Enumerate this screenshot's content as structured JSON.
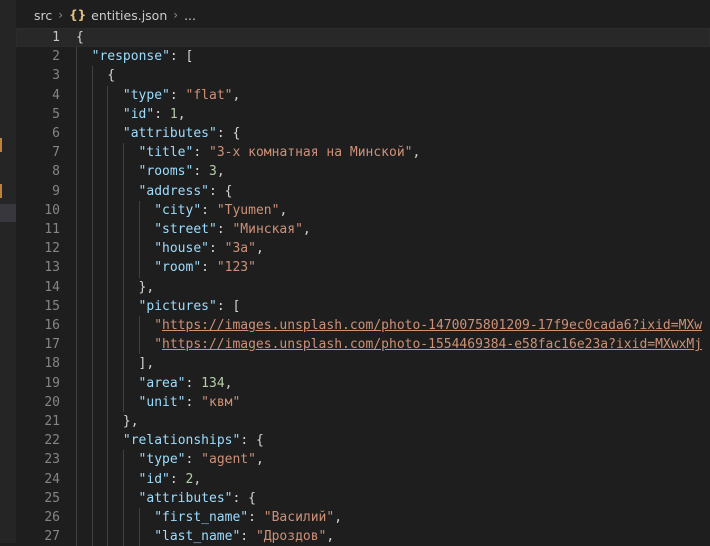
{
  "breadcrumb": {
    "folder": "src",
    "file_icon": "{}",
    "file": "entities.json",
    "more": "..."
  },
  "colors": {
    "background": "#1e1e1e",
    "key": "#9cdcfe",
    "string": "#ce9178",
    "number": "#b5cea8",
    "punct": "#d4d4d4",
    "line_number": "#858585"
  },
  "editor": {
    "active_line": 1,
    "lines": [
      {
        "n": "1",
        "indent": 0,
        "tokens": [
          [
            "p",
            "{"
          ]
        ]
      },
      {
        "n": "2",
        "indent": 1,
        "tokens": [
          [
            "k",
            "\"response\""
          ],
          [
            "p",
            ": ["
          ]
        ]
      },
      {
        "n": "3",
        "indent": 2,
        "tokens": [
          [
            "p",
            "{"
          ]
        ]
      },
      {
        "n": "4",
        "indent": 3,
        "tokens": [
          [
            "k",
            "\"type\""
          ],
          [
            "p",
            ": "
          ],
          [
            "s",
            "\"flat\""
          ],
          [
            "p",
            ","
          ]
        ]
      },
      {
        "n": "5",
        "indent": 3,
        "tokens": [
          [
            "k",
            "\"id\""
          ],
          [
            "p",
            ": "
          ],
          [
            "n",
            "1"
          ],
          [
            "p",
            ","
          ]
        ]
      },
      {
        "n": "6",
        "indent": 3,
        "tokens": [
          [
            "k",
            "\"attributes\""
          ],
          [
            "p",
            ": {"
          ]
        ]
      },
      {
        "n": "7",
        "indent": 4,
        "tokens": [
          [
            "k",
            "\"title\""
          ],
          [
            "p",
            ": "
          ],
          [
            "s",
            "\"3-х комнатная на Минской\""
          ],
          [
            "p",
            ","
          ]
        ]
      },
      {
        "n": "8",
        "indent": 4,
        "tokens": [
          [
            "k",
            "\"rooms\""
          ],
          [
            "p",
            ": "
          ],
          [
            "n",
            "3"
          ],
          [
            "p",
            ","
          ]
        ]
      },
      {
        "n": "9",
        "indent": 4,
        "tokens": [
          [
            "k",
            "\"address\""
          ],
          [
            "p",
            ": {"
          ]
        ]
      },
      {
        "n": "10",
        "indent": 5,
        "tokens": [
          [
            "k",
            "\"city\""
          ],
          [
            "p",
            ": "
          ],
          [
            "s",
            "\"Tyumen\""
          ],
          [
            "p",
            ","
          ]
        ]
      },
      {
        "n": "11",
        "indent": 5,
        "tokens": [
          [
            "k",
            "\"street\""
          ],
          [
            "p",
            ": "
          ],
          [
            "s",
            "\"Минская\""
          ],
          [
            "p",
            ","
          ]
        ]
      },
      {
        "n": "12",
        "indent": 5,
        "tokens": [
          [
            "k",
            "\"house\""
          ],
          [
            "p",
            ": "
          ],
          [
            "s",
            "\"3a\""
          ],
          [
            "p",
            ","
          ]
        ]
      },
      {
        "n": "13",
        "indent": 5,
        "tokens": [
          [
            "k",
            "\"room\""
          ],
          [
            "p",
            ": "
          ],
          [
            "s",
            "\"123\""
          ]
        ]
      },
      {
        "n": "14",
        "indent": 4,
        "tokens": [
          [
            "p",
            "},"
          ]
        ]
      },
      {
        "n": "15",
        "indent": 4,
        "tokens": [
          [
            "k",
            "\"pictures\""
          ],
          [
            "p",
            ": ["
          ]
        ]
      },
      {
        "n": "16",
        "indent": 5,
        "tokens": [
          [
            "s",
            "\""
          ],
          [
            "u",
            "https://images.unsplash.com/photo-1470075801209-17f9ec0cada6?ixid=MXw"
          ]
        ]
      },
      {
        "n": "17",
        "indent": 5,
        "tokens": [
          [
            "s",
            "\""
          ],
          [
            "u",
            "https://images.unsplash.com/photo-1554469384-e58fac16e23a?ixid=MXwxMj"
          ]
        ]
      },
      {
        "n": "18",
        "indent": 4,
        "tokens": [
          [
            "p",
            "],"
          ]
        ]
      },
      {
        "n": "19",
        "indent": 4,
        "tokens": [
          [
            "k",
            "\"area\""
          ],
          [
            "p",
            ": "
          ],
          [
            "n",
            "134"
          ],
          [
            "p",
            ","
          ]
        ]
      },
      {
        "n": "20",
        "indent": 4,
        "tokens": [
          [
            "k",
            "\"unit\""
          ],
          [
            "p",
            ": "
          ],
          [
            "s",
            "\"квм\""
          ]
        ]
      },
      {
        "n": "21",
        "indent": 3,
        "tokens": [
          [
            "p",
            "},"
          ]
        ]
      },
      {
        "n": "22",
        "indent": 3,
        "tokens": [
          [
            "k",
            "\"relationships\""
          ],
          [
            "p",
            ": {"
          ]
        ]
      },
      {
        "n": "23",
        "indent": 4,
        "tokens": [
          [
            "k",
            "\"type\""
          ],
          [
            "p",
            ": "
          ],
          [
            "s",
            "\"agent\""
          ],
          [
            "p",
            ","
          ]
        ]
      },
      {
        "n": "24",
        "indent": 4,
        "tokens": [
          [
            "k",
            "\"id\""
          ],
          [
            "p",
            ": "
          ],
          [
            "n",
            "2"
          ],
          [
            "p",
            ","
          ]
        ]
      },
      {
        "n": "25",
        "indent": 4,
        "tokens": [
          [
            "k",
            "\"attributes\""
          ],
          [
            "p",
            ": {"
          ]
        ]
      },
      {
        "n": "26",
        "indent": 5,
        "tokens": [
          [
            "k",
            "\"first_name\""
          ],
          [
            "p",
            ": "
          ],
          [
            "s",
            "\"Василий\""
          ],
          [
            "p",
            ","
          ]
        ]
      },
      {
        "n": "27",
        "indent": 5,
        "tokens": [
          [
            "k",
            "\"last_name\""
          ],
          [
            "p",
            ": "
          ],
          [
            "s",
            "\"Дроздов\""
          ],
          [
            "p",
            ","
          ]
        ]
      }
    ]
  }
}
